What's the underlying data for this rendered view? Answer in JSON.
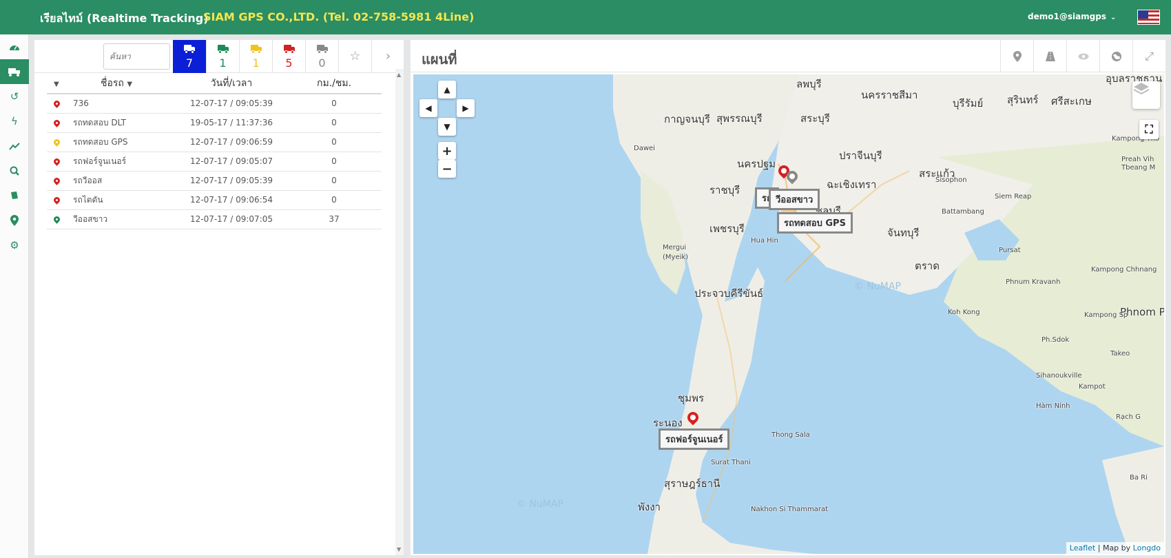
{
  "header": {
    "title": "เรียลไทม์ (Realtime Tracking)",
    "company": "SIAM GPS CO.,LTD. (Tel. 02-758-5981 4Line)",
    "user": "demo1@siamgps",
    "flag_icon": "us-flag-icon"
  },
  "sidebar": {
    "items": [
      {
        "icon": "dashboard-icon"
      },
      {
        "icon": "truck-icon",
        "active": true
      },
      {
        "icon": "history-icon"
      },
      {
        "icon": "bolt-icon"
      },
      {
        "icon": "chart-line-icon"
      },
      {
        "icon": "search-icon"
      },
      {
        "icon": "book-icon"
      },
      {
        "icon": "map-marker-icon"
      },
      {
        "icon": "gear-icon"
      }
    ]
  },
  "vehicles_panel": {
    "search_placeholder": "ค้นหา",
    "filters": [
      {
        "name": "all",
        "count": "7",
        "color": "#ffffff"
      },
      {
        "name": "green",
        "count": "1",
        "color": "#1e8a5a"
      },
      {
        "name": "yellow",
        "count": "1",
        "color": "#f0c419"
      },
      {
        "name": "red",
        "count": "5",
        "color": "#d62020"
      },
      {
        "name": "gray",
        "count": "0",
        "color": "#888888"
      }
    ],
    "columns": {
      "name": "ชื่อรถ",
      "datetime": "วันที่/เวลา",
      "speed": "กม./ชม."
    },
    "rows": [
      {
        "name": "736",
        "datetime": "12-07-17 / 09:05:39",
        "speed": "0",
        "status_color": "#d62020"
      },
      {
        "name": "รถทดสอบ DLT",
        "datetime": "19-05-17 / 11:37:36",
        "speed": "0",
        "status_color": "#d62020"
      },
      {
        "name": "รถทดสอบ GPS",
        "datetime": "12-07-17 / 09:06:59",
        "speed": "0",
        "status_color": "#f0c419"
      },
      {
        "name": "รถฟอร์จูนเนอร์",
        "datetime": "12-07-17 / 09:05:07",
        "speed": "0",
        "status_color": "#d62020"
      },
      {
        "name": "รถวีออส",
        "datetime": "12-07-17 / 09:05:39",
        "speed": "0",
        "status_color": "#d62020"
      },
      {
        "name": "รถไตตัน",
        "datetime": "12-07-17 / 09:06:54",
        "speed": "0",
        "status_color": "#d62020"
      },
      {
        "name": "วีออสขาว",
        "datetime": "12-07-17 / 09:07:05",
        "speed": "37",
        "status_color": "#1e8a5a"
      }
    ]
  },
  "map_panel": {
    "title": "แผนที่",
    "toolbar": [
      "marker-icon",
      "road-icon",
      "eye-icon",
      "globe-icon",
      "expand-icon"
    ],
    "places": [
      {
        "name": "ลพบุรี",
        "cls": ""
      },
      {
        "name": "นครราชสีมา",
        "cls": ""
      },
      {
        "name": "อุบลราชธาน",
        "cls": ""
      },
      {
        "name": "บุรีรัมย์",
        "cls": ""
      },
      {
        "name": "สุรินทร์",
        "cls": ""
      },
      {
        "name": "ศรีสะเกษ",
        "cls": ""
      },
      {
        "name": "กาญจนบุรี",
        "cls": ""
      },
      {
        "name": "สุพรรณบุรี",
        "cls": ""
      },
      {
        "name": "สระบุรี",
        "cls": ""
      },
      {
        "name": "Dawei",
        "cls": "sm"
      },
      {
        "name": "นครปฐม",
        "cls": ""
      },
      {
        "name": "ปราจีนบุรี",
        "cls": ""
      },
      {
        "name": "สระแก้ว",
        "cls": ""
      },
      {
        "name": "ราชบุรี",
        "cls": ""
      },
      {
        "name": "ฉะเชิงเทรา",
        "cls": ""
      },
      {
        "name": "ชลบุรี",
        "cls": ""
      },
      {
        "name": "เพชรบุรี",
        "cls": ""
      },
      {
        "name": "จันทบุรี",
        "cls": ""
      },
      {
        "name": "Mergui",
        "cls": "sm"
      },
      {
        "name": "(Myeik)",
        "cls": "sm"
      },
      {
        "name": "Hua Hin",
        "cls": "sm"
      },
      {
        "name": "ตราด",
        "cls": ""
      },
      {
        "name": "ประจวบคีรีขันธ์",
        "cls": ""
      },
      {
        "name": "ชุมพร",
        "cls": ""
      },
      {
        "name": "ระนอง",
        "cls": ""
      },
      {
        "name": "Thong Sala",
        "cls": "sm"
      },
      {
        "name": "Surat Thani",
        "cls": "sm"
      },
      {
        "name": "สุราษฎร์ธานี",
        "cls": ""
      },
      {
        "name": "พังงา",
        "cls": ""
      },
      {
        "name": "Nakhon Si Thammarat",
        "cls": "sm"
      },
      {
        "name": "Sisophon",
        "cls": "sm"
      },
      {
        "name": "Siem Reap",
        "cls": "sm"
      },
      {
        "name": "Battambang",
        "cls": "sm"
      },
      {
        "name": "Pursat",
        "cls": "sm"
      },
      {
        "name": "Kampong Chhnang",
        "cls": "sm"
      },
      {
        "name": "Koh Kong",
        "cls": "sm"
      },
      {
        "name": "Phnom P",
        "cls": ""
      },
      {
        "name": "Sihanoukville",
        "cls": "sm"
      },
      {
        "name": "Hàm Ninh",
        "cls": "sm"
      },
      {
        "name": "Kampong Tho",
        "cls": "sm"
      },
      {
        "name": "Tbeang M",
        "cls": "sm"
      },
      {
        "name": "Preah Vih",
        "cls": "sm"
      },
      {
        "name": "Phnum Kravanh",
        "cls": "sm"
      },
      {
        "name": "Kampong Sp",
        "cls": "sm"
      },
      {
        "name": "Ph.Sdok",
        "cls": "sm"
      },
      {
        "name": "Takeo",
        "cls": "sm"
      },
      {
        "name": "Kampot",
        "cls": "sm"
      },
      {
        "name": "Rạch G",
        "cls": "sm"
      },
      {
        "name": "Ba Ri",
        "cls": "sm"
      }
    ],
    "vehicle_labels": [
      "รถ",
      "วีออสขาว",
      "รถทดสอบ GPS",
      "รถฟอร์จูนเนอร์"
    ],
    "watermark": "© NuMAP",
    "attribution": {
      "leaflet": "Leaflet",
      "sep": " | Map by ",
      "longdo": "Longdo"
    }
  }
}
